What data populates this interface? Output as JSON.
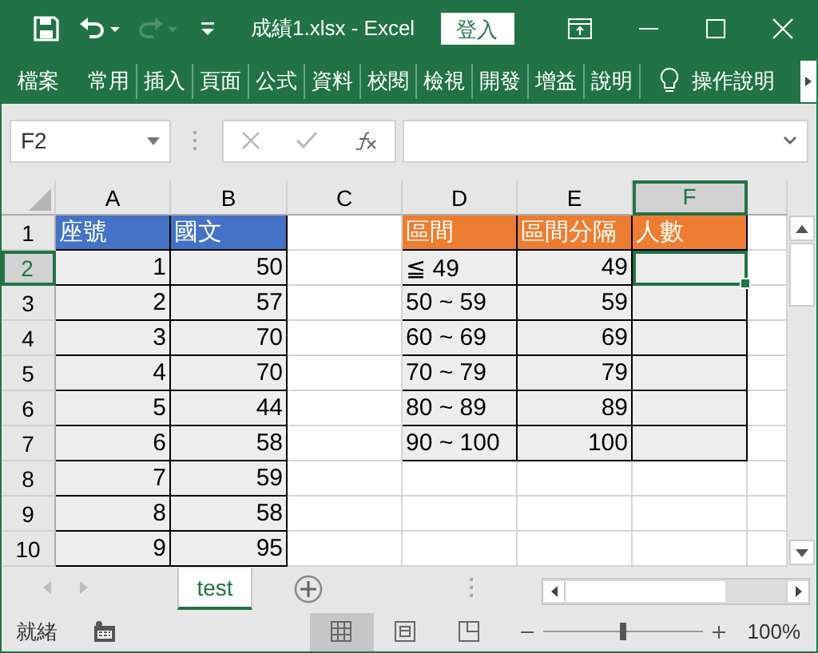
{
  "window": {
    "title": "成績1.xlsx  -  Excel",
    "sign_in": "登入"
  },
  "ribbon": {
    "tabs": [
      {
        "label": "檔案"
      },
      {
        "label": "常用"
      },
      {
        "label": "插入"
      },
      {
        "label": "頁面"
      },
      {
        "label": "公式"
      },
      {
        "label": "資料"
      },
      {
        "label": "校閱"
      },
      {
        "label": "檢視"
      },
      {
        "label": "開發"
      },
      {
        "label": "增益"
      },
      {
        "label": "說明"
      }
    ],
    "tell_me": "操作說明"
  },
  "formula_bar": {
    "name_box": "F2"
  },
  "sheet": {
    "columns": [
      {
        "label": "A",
        "selected": false
      },
      {
        "label": "B",
        "selected": false
      },
      {
        "label": "C",
        "selected": false
      },
      {
        "label": "D",
        "selected": false
      },
      {
        "label": "E",
        "selected": false
      },
      {
        "label": "F",
        "selected": true
      }
    ],
    "rows": [
      {
        "label": "1",
        "selected": false,
        "cells": [
          {
            "kind": "head-blue",
            "text": "座號",
            "selected": false
          },
          {
            "kind": "head-blue",
            "text": "國文",
            "selected": false
          },
          {
            "kind": "blank",
            "selected": false
          },
          {
            "kind": "head-orange",
            "text": "區間",
            "selected": false
          },
          {
            "kind": "head-orange",
            "text": "區間分隔",
            "selected": false
          },
          {
            "kind": "head-orange",
            "text": "人數",
            "selected": false
          }
        ]
      },
      {
        "label": "2",
        "selected": true,
        "cells": [
          {
            "kind": "num",
            "text": "1",
            "selected": false
          },
          {
            "kind": "num",
            "text": "50",
            "selected": false
          },
          {
            "kind": "blank",
            "selected": false
          },
          {
            "kind": "label",
            "text": "≦ 49",
            "selected": false
          },
          {
            "kind": "num",
            "text": "49",
            "selected": false
          },
          {
            "kind": "num",
            "selected": true
          }
        ]
      },
      {
        "label": "3",
        "selected": false,
        "cells": [
          {
            "kind": "num",
            "text": "2",
            "selected": false
          },
          {
            "kind": "num",
            "text": "57",
            "selected": false
          },
          {
            "kind": "blank",
            "selected": false
          },
          {
            "kind": "label",
            "text": "50 ~ 59",
            "selected": false
          },
          {
            "kind": "num",
            "text": "59",
            "selected": false
          },
          {
            "kind": "num",
            "selected": false
          }
        ]
      },
      {
        "label": "4",
        "selected": false,
        "cells": [
          {
            "kind": "num",
            "text": "3",
            "selected": false
          },
          {
            "kind": "num",
            "text": "70",
            "selected": false
          },
          {
            "kind": "blank",
            "selected": false
          },
          {
            "kind": "label",
            "text": "60 ~ 69",
            "selected": false
          },
          {
            "kind": "num",
            "text": "69",
            "selected": false
          },
          {
            "kind": "num",
            "selected": false
          }
        ]
      },
      {
        "label": "5",
        "selected": false,
        "cells": [
          {
            "kind": "num",
            "text": "4",
            "selected": false
          },
          {
            "kind": "num",
            "text": "70",
            "selected": false
          },
          {
            "kind": "blank",
            "selected": false
          },
          {
            "kind": "label",
            "text": "70 ~ 79",
            "selected": false
          },
          {
            "kind": "num",
            "text": "79",
            "selected": false
          },
          {
            "kind": "num",
            "selected": false
          }
        ]
      },
      {
        "label": "6",
        "selected": false,
        "cells": [
          {
            "kind": "num",
            "text": "5",
            "selected": false
          },
          {
            "kind": "num",
            "text": "44",
            "selected": false
          },
          {
            "kind": "blank",
            "selected": false
          },
          {
            "kind": "label",
            "text": "80 ~ 89",
            "selected": false
          },
          {
            "kind": "num",
            "text": "89",
            "selected": false
          },
          {
            "kind": "num",
            "selected": false
          }
        ]
      },
      {
        "label": "7",
        "selected": false,
        "cells": [
          {
            "kind": "num",
            "text": "6",
            "selected": false
          },
          {
            "kind": "num",
            "text": "58",
            "selected": false
          },
          {
            "kind": "blank",
            "selected": false
          },
          {
            "kind": "label",
            "text": "90 ~ 100",
            "selected": false
          },
          {
            "kind": "num",
            "text": "100",
            "selected": false
          },
          {
            "kind": "num",
            "selected": false
          }
        ]
      },
      {
        "label": "8",
        "selected": false,
        "cells": [
          {
            "kind": "num",
            "text": "7",
            "selected": false
          },
          {
            "kind": "num",
            "text": "59",
            "selected": false
          },
          {
            "kind": "blank",
            "selected": false
          },
          {
            "kind": "blank",
            "selected": false
          },
          {
            "kind": "blank",
            "selected": false
          },
          {
            "kind": "blank",
            "selected": false
          }
        ]
      },
      {
        "label": "9",
        "selected": false,
        "cells": [
          {
            "kind": "num",
            "text": "8",
            "selected": false
          },
          {
            "kind": "num",
            "text": "58",
            "selected": false
          },
          {
            "kind": "blank",
            "selected": false
          },
          {
            "kind": "blank",
            "selected": false
          },
          {
            "kind": "blank",
            "selected": false
          },
          {
            "kind": "blank",
            "selected": false
          }
        ]
      },
      {
        "label": "10",
        "selected": false,
        "cells": [
          {
            "kind": "num",
            "text": "9",
            "selected": false
          },
          {
            "kind": "num",
            "text": "95",
            "selected": false
          },
          {
            "kind": "blank",
            "selected": false
          },
          {
            "kind": "blank",
            "selected": false
          },
          {
            "kind": "blank",
            "selected": false
          },
          {
            "kind": "blank",
            "selected": false
          }
        ]
      }
    ]
  },
  "sheet_tabs": [
    {
      "label": "test",
      "selected": true
    }
  ],
  "status_bar": {
    "status": "就緒",
    "zoom_level": {
      "level": 0.5
    },
    "zoom": "100%"
  }
}
